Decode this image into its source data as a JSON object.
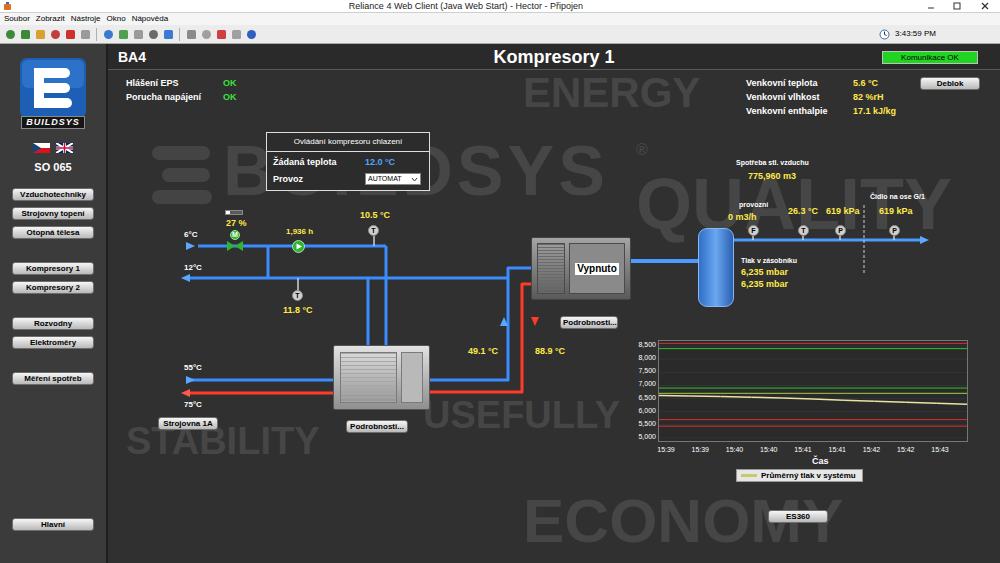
{
  "window": {
    "title": "Reliance 4 Web Client (Java Web Start) - Hector - Připojen"
  },
  "menu": [
    "Soubor",
    "Zobrazit",
    "Nástroje",
    "Okno",
    "Nápověda"
  ],
  "toolbar": {
    "time": "3:43:59 PM"
  },
  "sidebar": {
    "logo": "BUILDSYS",
    "code": "SO 065",
    "groups": [
      [
        "Vzduchotechniky",
        "Strojovny topení",
        "Otopná tělesa"
      ],
      [
        "Kompresory 1",
        "Kompresory 2"
      ],
      [
        "Rozvodny",
        "Elektroměry"
      ],
      [
        "Měření spotřeb"
      ]
    ],
    "bottom": "Hlavní"
  },
  "header": {
    "id": "BA4",
    "title": "Kompresory 1",
    "badge": "Komunikace OK"
  },
  "alarms": [
    {
      "label": "Hlášení EPS",
      "value": "OK"
    },
    {
      "label": "Porucha napájení",
      "value": "OK"
    }
  ],
  "outdoor": [
    {
      "label": "Venkovní teplota",
      "value": "5.6 °C"
    },
    {
      "label": "Venkovní vlhkost",
      "value": "82 %rH"
    },
    {
      "label": "Venkovní enthalpie",
      "value": "17.1 kJ/kg"
    }
  ],
  "deblok": "Deblok",
  "control": {
    "title": "Ovládání kompresoru chlazení",
    "setpoint_label": "Žádaná teplota",
    "setpoint": "12.0 °C",
    "mode_label": "Provoz",
    "mode": "AUTOMAT"
  },
  "watermarks": [
    "ENERGY",
    "BUILDSYS",
    "®",
    "QUALITY",
    "STABILITY",
    "USEFULLY",
    "ECONOMY"
  ],
  "diagram": {
    "chw_in": "6°C",
    "chw_out": "12°C",
    "valve": {
      "letter": "M",
      "reading": "27 %",
      "level": 0.27
    },
    "pump": {
      "reading": "1,936 h",
      "running": true
    },
    "temp_supply": {
      "letter": "T",
      "reading": "10.5 °C"
    },
    "temp_return": {
      "letter": "T",
      "reading": "11.8 °C"
    },
    "hw_in": "55°C",
    "hw_out": "75°C",
    "hw_return_temp": "49.1 °C",
    "hw_supply_temp": "88.9 °C",
    "compressor": {
      "state": "Vypnuto",
      "running": false,
      "details": "Podrobnosti..."
    },
    "chiller": {
      "details": "Podrobnosti..."
    },
    "room_button": "Strojovna 1A",
    "air": {
      "consumption_label": "Spotřeba stl. vzduchu",
      "consumption": "775,960 m3",
      "tank_label": "Tlak v zásobníku",
      "tank_pressure": [
        "6,235 mbar",
        "6,235 mbar"
      ],
      "sensors": [
        {
          "letter": "F",
          "label": "provozní",
          "reading": "0 m3/h"
        },
        {
          "letter": "T",
          "reading": "26.3 °C"
        },
        {
          "letter": "P",
          "reading": "619 kPa"
        },
        {
          "letter": "P",
          "label": "Čidlo na ose G/1",
          "reading": "619 kPa"
        }
      ]
    },
    "es_button": "ES360"
  },
  "chart": {
    "y_ticks": [
      "8,500",
      "8,000",
      "7,500",
      "7,000",
      "6,500",
      "6,000",
      "5,500",
      "5,000"
    ],
    "x_ticks": [
      "15:39",
      "15:39",
      "15:40",
      "15:40",
      "15:41",
      "15:41",
      "15:42",
      "15:42",
      "15:43"
    ],
    "x_title": "Čas",
    "series": [
      {
        "name": "Průměrný tlak v systému",
        "color": "#e6e6a0",
        "values": [
          6620,
          6600,
          6580,
          6550,
          6520,
          6480,
          6440,
          6400,
          6360,
          6320,
          6280
        ]
      }
    ],
    "limits": [
      {
        "value": 8600,
        "color": "#d83030"
      },
      {
        "value": 8400,
        "color": "#30c030"
      },
      {
        "value": 6900,
        "color": "#30c030"
      },
      {
        "value": 6700,
        "color": "#a0d040"
      },
      {
        "value": 5700,
        "color": "#d83030"
      },
      {
        "value": 5450,
        "color": "#d83030"
      }
    ]
  }
}
